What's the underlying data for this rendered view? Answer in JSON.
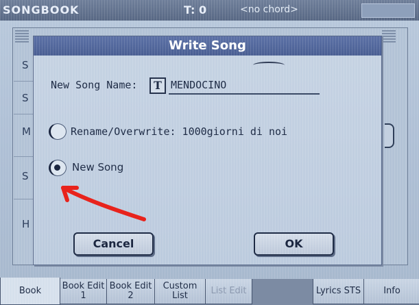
{
  "topbar": {
    "app_title": "SONGBOOK",
    "tempo": "T: 0",
    "chord": "<no chord>"
  },
  "background": {
    "row_labels": [
      "S",
      "S",
      "M",
      "S",
      "H"
    ]
  },
  "dialog": {
    "title": "Write Song",
    "name_label": "New Song Name:",
    "text_icon_glyph": "T",
    "name_value": "MENDOCINO",
    "options": [
      {
        "label": "Rename/Overwrite: 1000giorni di noi",
        "selected": false
      },
      {
        "label": "New Song",
        "selected": true
      }
    ],
    "cancel_label": "Cancel",
    "ok_label": "OK"
  },
  "tabs": [
    {
      "label": "Book",
      "state": "active"
    },
    {
      "label": "Book Edit 1",
      "state": "normal"
    },
    {
      "label": "Book Edit 2",
      "state": "normal"
    },
    {
      "label": "Custom List",
      "state": "normal"
    },
    {
      "label": "List Edit",
      "state": "disabled"
    },
    {
      "label": "Lyrics STS",
      "state": "normal"
    },
    {
      "label": "Info",
      "state": "normal"
    }
  ],
  "annotation": {
    "arrow_color": "#e8231c"
  }
}
